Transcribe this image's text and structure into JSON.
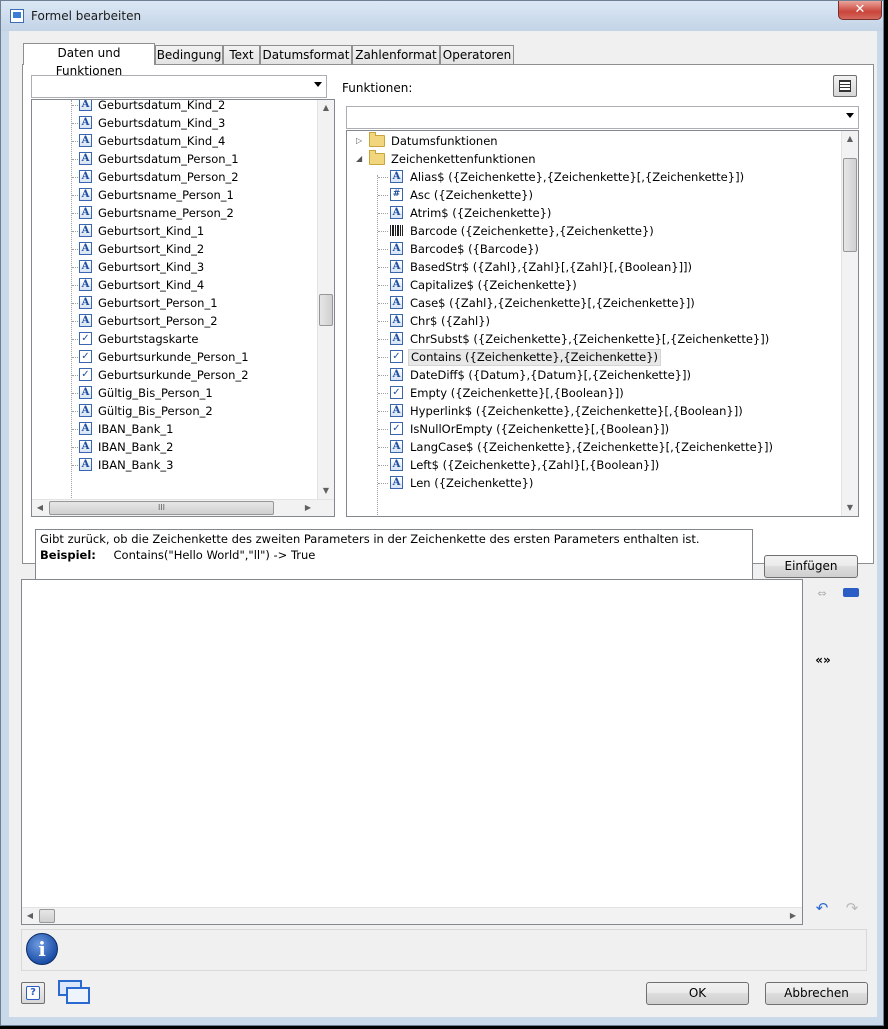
{
  "window": {
    "title": "Formel bearbeiten",
    "close_symbol": "✕"
  },
  "tabs": [
    {
      "label": "Daten und Funktionen",
      "active": true
    },
    {
      "label": "Bedingung"
    },
    {
      "label": "Text"
    },
    {
      "label": "Datumsformat"
    },
    {
      "label": "Zahlenformat"
    },
    {
      "label": "Operatoren"
    }
  ],
  "left_panel": {
    "combo_value": "",
    "items": [
      {
        "icon": "A",
        "label": "Geburtsdatum_Kind_2"
      },
      {
        "icon": "A",
        "label": "Geburtsdatum_Kind_3"
      },
      {
        "icon": "A",
        "label": "Geburtsdatum_Kind_4"
      },
      {
        "icon": "A",
        "label": "Geburtsdatum_Person_1"
      },
      {
        "icon": "A",
        "label": "Geburtsdatum_Person_2"
      },
      {
        "icon": "A",
        "label": "Geburtsname_Person_1"
      },
      {
        "icon": "A",
        "label": "Geburtsname_Person_2"
      },
      {
        "icon": "A",
        "label": "Geburtsort_Kind_1"
      },
      {
        "icon": "A",
        "label": "Geburtsort_Kind_2"
      },
      {
        "icon": "A",
        "label": "Geburtsort_Kind_3"
      },
      {
        "icon": "A",
        "label": "Geburtsort_Kind_4"
      },
      {
        "icon": "A",
        "label": "Geburtsort_Person_1"
      },
      {
        "icon": "A",
        "label": "Geburtsort_Person_2"
      },
      {
        "icon": "chk",
        "label": "Geburtstagskarte"
      },
      {
        "icon": "chk",
        "label": "Geburtsurkunde_Person_1"
      },
      {
        "icon": "chk",
        "label": "Geburtsurkunde_Person_2"
      },
      {
        "icon": "A",
        "label": "Gültig_Bis_Person_1"
      },
      {
        "icon": "A",
        "label": "Gültig_Bis_Person_2"
      },
      {
        "icon": "A",
        "label": "IBAN_Bank_1"
      },
      {
        "icon": "A",
        "label": "IBAN_Bank_2"
      },
      {
        "icon": "A",
        "label": "IBAN_Bank_3"
      }
    ],
    "hscroll_grip": "III"
  },
  "right_panel": {
    "label": "Funktionen:",
    "combo_value": "",
    "folders": [
      {
        "label": "Datumsfunktionen",
        "expanded": false
      },
      {
        "label": "Zeichenkettenfunktionen",
        "expanded": true
      }
    ],
    "functions": [
      {
        "icon": "A",
        "label": "Alias$ ({Zeichenkette},{Zeichenkette}[,{Zeichenkette}])"
      },
      {
        "icon": "hash",
        "label": "Asc ({Zeichenkette})"
      },
      {
        "icon": "A",
        "label": "Atrim$ ({Zeichenkette})"
      },
      {
        "icon": "bc",
        "label": "Barcode ({Zeichenkette},{Zeichenkette})"
      },
      {
        "icon": "A",
        "label": "Barcode$ ({Barcode})"
      },
      {
        "icon": "A",
        "label": "BasedStr$ ({Zahl},{Zahl}[,{Zahl}[,{Boolean}]])"
      },
      {
        "icon": "A",
        "label": "Capitalize$ ({Zeichenkette})"
      },
      {
        "icon": "A",
        "label": "Case$ ({Zahl},{Zeichenkette}[,{Zeichenkette}])"
      },
      {
        "icon": "A",
        "label": "Chr$ ({Zahl})"
      },
      {
        "icon": "A",
        "label": "ChrSubst$ ({Zeichenkette},{Zeichenkette}[,{Zeichenkette}])"
      },
      {
        "icon": "chk",
        "label": "Contains ({Zeichenkette},{Zeichenkette})",
        "selected": true
      },
      {
        "icon": "A",
        "label": "DateDiff$ ({Datum},{Datum}[,{Zeichenkette}])"
      },
      {
        "icon": "chk",
        "label": "Empty ({Zeichenkette}[,{Boolean}])"
      },
      {
        "icon": "A",
        "label": "Hyperlink$ ({Zeichenkette},{Zeichenkette}[,{Boolean}])"
      },
      {
        "icon": "chk",
        "label": "IsNullOrEmpty ({Zeichenkette}[,{Boolean}])"
      },
      {
        "icon": "A",
        "label": "LangCase$ ({Zeichenkette},{Zeichenkette}[,{Zeichenkette}])"
      },
      {
        "icon": "A",
        "label": "Left$ ({Zeichenkette},{Zahl}[,{Boolean}])"
      },
      {
        "icon": "A",
        "label": "Len ({Zeichenkette})"
      }
    ]
  },
  "description": {
    "text": "Gibt zurück, ob die Zeichenkette des zweiten Parameters in der Zeichenkette des ersten Parameters enthalten ist.",
    "example_label": "Beispiel:",
    "example_value": "Contains(\"Hello World\",\"ll\") -> True"
  },
  "buttons": {
    "insert": "Einfügen",
    "ok": "OK",
    "cancel": "Abbrechen"
  },
  "editor": {
    "value": ""
  },
  "side_tools": {
    "format_symbol": "«»"
  },
  "icons": {
    "tree_toggle": "tree-view-icon",
    "wrap": "wrap-icon",
    "fold": "fold-icon",
    "undo": "undo-icon",
    "redo": "redo-icon",
    "info": "info-icon",
    "help": "help-icon",
    "window": "window-icon"
  }
}
